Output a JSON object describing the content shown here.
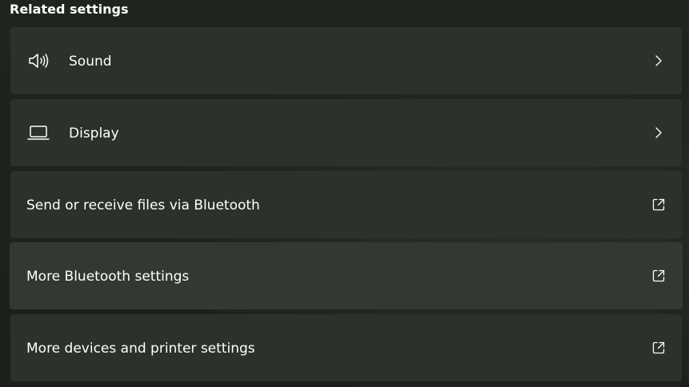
{
  "section": {
    "title": "Related settings"
  },
  "items": [
    {
      "label": "Sound",
      "icon": "speaker-icon",
      "trailing_icon": "chevron-right-icon"
    },
    {
      "label": "Display",
      "icon": "laptop-icon",
      "trailing_icon": "chevron-right-icon"
    },
    {
      "label": "Send or receive files via Bluetooth",
      "icon": "",
      "trailing_icon": "open-external-icon"
    },
    {
      "label": "More Bluetooth settings",
      "icon": "",
      "trailing_icon": "open-external-icon"
    },
    {
      "label": "More devices and printer settings",
      "icon": "",
      "trailing_icon": "open-external-icon"
    }
  ],
  "colors": {
    "background": "#1c211c",
    "card": "#2b312b",
    "card_hover": "#323832",
    "text": "#ffffff"
  }
}
